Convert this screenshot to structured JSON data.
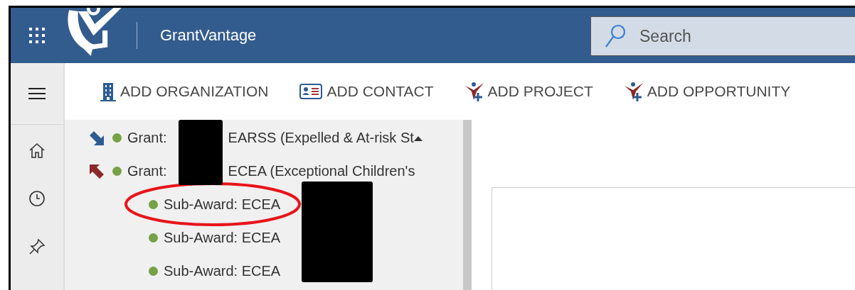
{
  "header": {
    "app_title": "GrantVantage",
    "search": {
      "placeholder": "Search"
    }
  },
  "toolbar": [
    {
      "label": "ADD ORGANIZATION",
      "kind": "organization"
    },
    {
      "label": "ADD CONTACT",
      "kind": "contact"
    },
    {
      "label": "ADD PROJECT",
      "kind": "project"
    },
    {
      "label": "ADD OPPORTUNITY",
      "kind": "opportunity"
    }
  ],
  "nav_rail": [
    {
      "kind": "menu"
    },
    {
      "kind": "home"
    },
    {
      "kind": "recent"
    },
    {
      "kind": "pinned"
    }
  ],
  "tree": [
    {
      "prefix": "Grant:",
      "title": "EARSS (Expelled & At-risk St",
      "kind": "incoming",
      "color": "#76a146"
    },
    {
      "prefix": "Grant:",
      "title": "ECEA (Exceptional Children's",
      "kind": "outgoing",
      "color": "#76a146",
      "children": [
        {
          "title": "Sub-Award: ECEA",
          "color": "#76a146",
          "circled": true
        },
        {
          "title": "Sub-Award: ECEA",
          "color": "#76a146",
          "circled": false
        },
        {
          "title": "Sub-Award: ECEA",
          "color": "#76a146",
          "circled": false
        }
      ]
    }
  ]
}
